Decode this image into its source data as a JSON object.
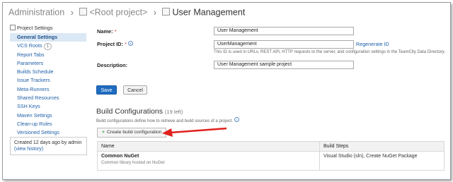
{
  "breadcrumb": {
    "root": "Administration",
    "project": "<Root project>",
    "current": "User Management"
  },
  "sidebar": {
    "heading": "Project Settings",
    "items": [
      {
        "label": "General Settings",
        "active": true
      },
      {
        "label": "VCS Roots",
        "badge": "1"
      },
      {
        "label": "Report Tabs"
      },
      {
        "label": "Parameters"
      },
      {
        "label": "Builds Schedule"
      },
      {
        "label": "Issue Trackers"
      },
      {
        "label": "Meta-Runners"
      },
      {
        "label": "Shared Resources"
      },
      {
        "label": "SSH Keys"
      },
      {
        "label": "Maven Settings"
      },
      {
        "label": "Clean-up Rules"
      },
      {
        "label": "Versioned Settings"
      }
    ],
    "created": {
      "text": "Created 12 days ago  by admin",
      "link": "(view history)"
    }
  },
  "form": {
    "name_label": "Name:",
    "name_value": "User Management",
    "id_label": "Project ID:",
    "id_value": "UserManagement",
    "regenerate": "Regenerate ID",
    "id_hint": "This ID is used in URLs, REST API, HTTP requests to the server, and configuration settings in the TeamCity Data Directory.",
    "desc_label": "Description:",
    "desc_value": "User Management sample project",
    "required_mark": "*",
    "save": "Save",
    "cancel": "Cancel"
  },
  "build_configs": {
    "title": "Build Configurations",
    "count": "(19 left)",
    "hint": "Build configurations define how to retrieve and build sources of a project.",
    "create_button": "Create build configuration",
    "columns": [
      "Name",
      "Build Steps"
    ],
    "rows": [
      {
        "name": "Common NuGet",
        "description": "Common library hosted on NuGet",
        "steps": "Visual Studio (sln), Create NuGet Package"
      }
    ]
  },
  "colors": {
    "link": "#1f5fa8",
    "primary_button": "#1e6cc1",
    "active_bg": "#dbe8f5",
    "arrow": "#e0201c"
  },
  "icons": {
    "breadcrumb_sep": "chevron-right-icon",
    "project": "project-icon",
    "info": "info-icon",
    "add": "plus-icon"
  }
}
